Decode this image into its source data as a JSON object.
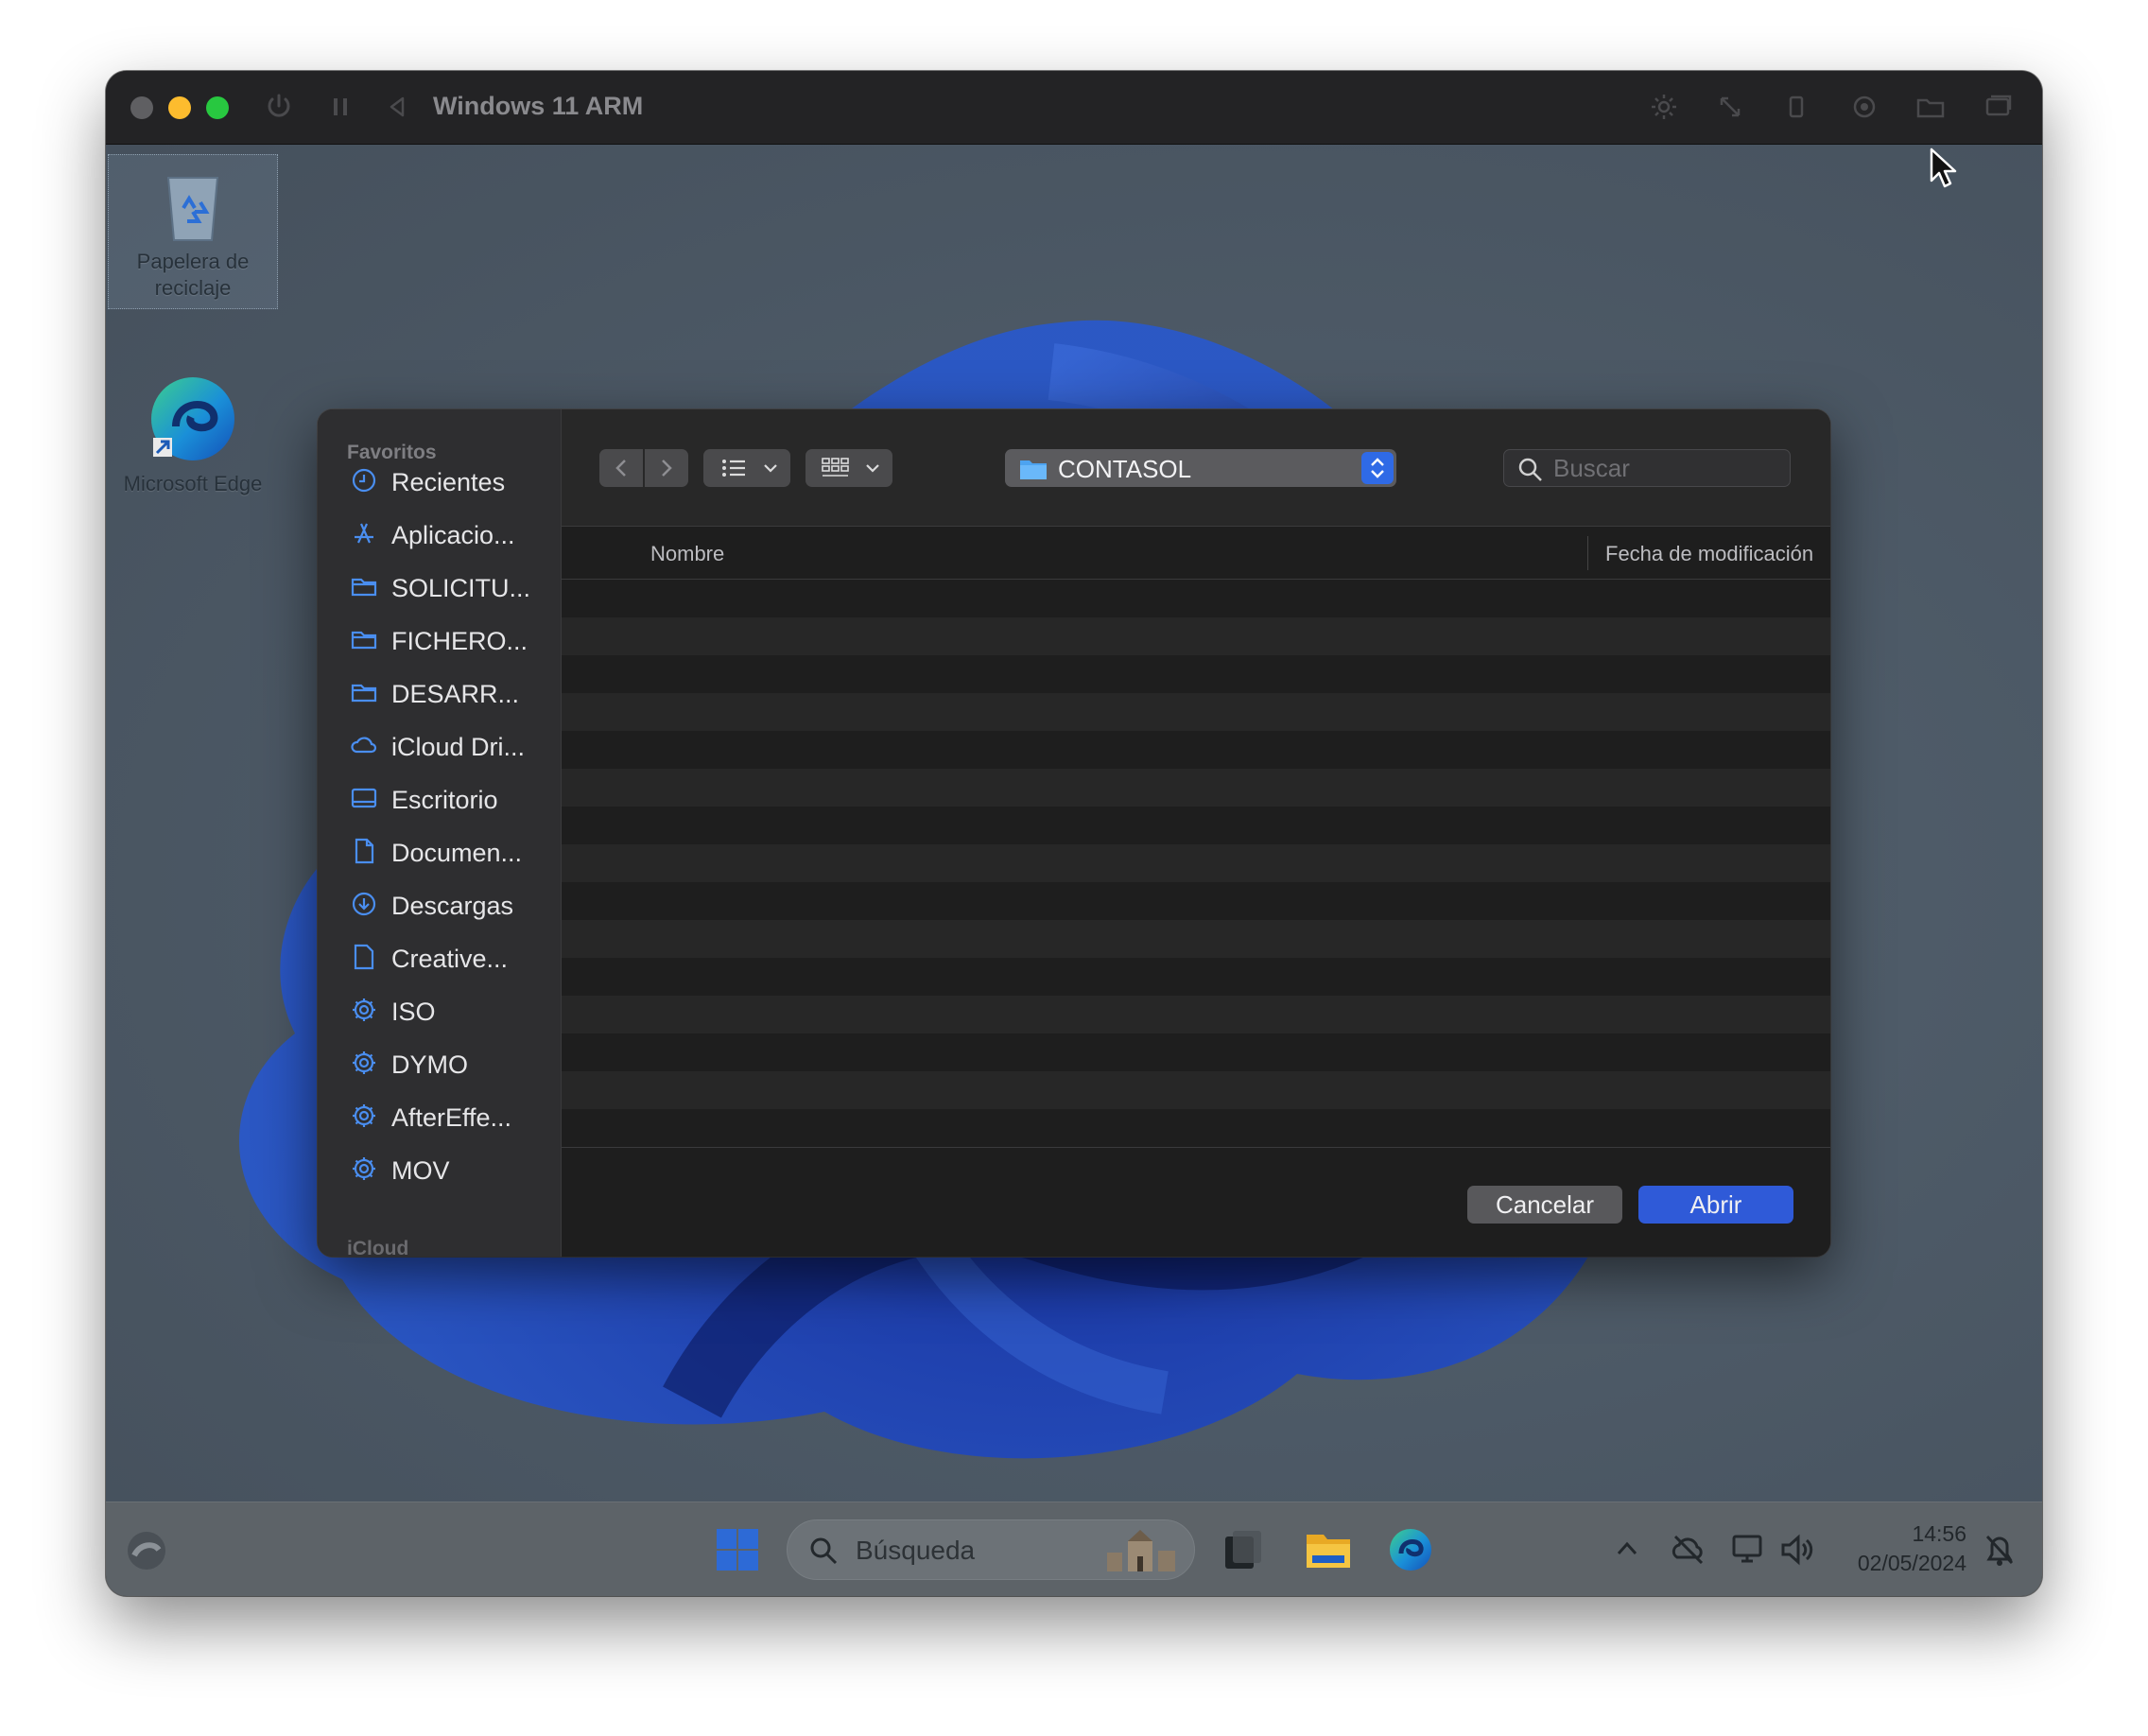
{
  "window": {
    "title": "Windows 11 ARM"
  },
  "desktop": {
    "icons": [
      {
        "label": "Papelera de reciclaje",
        "icon": "recycle-bin-icon"
      },
      {
        "label": "Microsoft Edge",
        "icon": "edge-icon"
      }
    ]
  },
  "dialog": {
    "sidebar": {
      "favorites_header": "Favoritos",
      "items": [
        {
          "label": "Recientes",
          "icon": "clock-icon"
        },
        {
          "label": "Aplicacio...",
          "icon": "applications-icon"
        },
        {
          "label": "SOLICITU...",
          "icon": "folder-icon"
        },
        {
          "label": "FICHERO...",
          "icon": "folder-icon"
        },
        {
          "label": "DESARR...",
          "icon": "folder-icon"
        },
        {
          "label": "iCloud Dri...",
          "icon": "cloud-icon"
        },
        {
          "label": "Escritorio",
          "icon": "desktop-icon"
        },
        {
          "label": "Documen...",
          "icon": "document-icon"
        },
        {
          "label": "Descargas",
          "icon": "download-icon"
        },
        {
          "label": "Creative...",
          "icon": "file-icon"
        },
        {
          "label": "ISO",
          "icon": "gear-icon"
        },
        {
          "label": "DYMO",
          "icon": "gear-icon"
        },
        {
          "label": "AfterEffe...",
          "icon": "gear-icon"
        },
        {
          "label": "MOV",
          "icon": "gear-icon"
        }
      ],
      "next_section": "iCloud"
    },
    "toolbar": {
      "current_folder": "CONTASOL",
      "search_placeholder": "Buscar"
    },
    "columns": {
      "name": "Nombre",
      "modified": "Fecha de modificación"
    },
    "buttons": {
      "cancel": "Cancelar",
      "open": "Abrir"
    }
  },
  "taskbar": {
    "search_placeholder": "Búsqueda",
    "time": "14:56",
    "date": "02/05/2024"
  },
  "colors": {
    "accent": "#2f5ad8",
    "sidebar_icon": "#4a8ef0"
  }
}
